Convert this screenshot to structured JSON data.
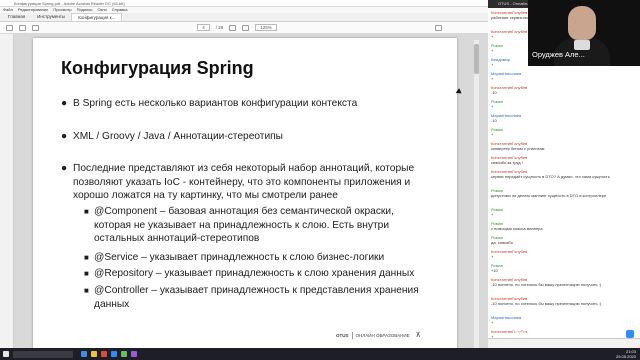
{
  "reader": {
    "window_title": "Конфигурация Spring.pdf - Adobe Acrobat Reader DC (64-bit)",
    "menu": [
      "Файл",
      "Редактирование",
      "Просмотр",
      "Подпись",
      "Окно",
      "Справка"
    ],
    "tabs": [
      "Главная",
      "Инструменты",
      "Конфигурация к..."
    ],
    "page_current": "4",
    "page_total": "/ 26",
    "zoom": "125%"
  },
  "slide": {
    "title": "Конфигурация Spring",
    "bullets": [
      "В Spring есть несколько вариантов конфигурации контекста",
      "XML / Groovy / Java / Аннотации-стереотипы"
    ],
    "bullet3_lines": [
      "Последние представляют из себя некоторый набор аннотаций, которые",
      "позволяют указать IoC - контейнеру, что  это компоненты приложения и",
      "хорошо ложатся на ту картинку, что мы смотрели ранее"
    ],
    "sub1_lines": [
      "@Component – базовая аннотация без семантической окраски,",
      "которая не указывает на принадлежность к слою. Есть внутри",
      "остальных аннотаций-стереотипов"
    ],
    "sub2": "@Service – указывает принадлежность к слою бизнес-логики",
    "sub3": "@Repository – указывает принадлежность к слою хранения данных",
    "sub4_lines": [
      "@Controller – указывает принадлежность к представления хранения",
      "данных"
    ],
    "footer_brand": "OTUS",
    "footer_text": "ОНЛАЙН ОБРАЗОВАНИЕ"
  },
  "chat": {
    "title": "OTUS - Онлайн-образование",
    "messages": [
      {
        "who": "КонстантинГолубев",
        "text": "работают сервисом application.yaml"
      },
      {
        "who": "КонстантинГолубев",
        "text": "+"
      },
      {
        "who": "Роман",
        "text": "+"
      },
      {
        "who": "Владимир",
        "text": "+"
      },
      {
        "who": "МаринНиколаев",
        "text": "+"
      },
      {
        "who": "КонстантинГолубев",
        "text": "-10"
      },
      {
        "who": "Роман",
        "text": "+"
      },
      {
        "who": "МаринНиколаев",
        "text": "-10"
      },
      {
        "who": "Роман",
        "text": "+"
      },
      {
        "who": "КонстантинГолубев",
        "text": "конвертер бином с утилитам"
      },
      {
        "who": "КонстантинГолубев",
        "text": "спасибо за труд !"
      },
      {
        "who": "КонстантинГолубев",
        "text": "сервис передаёт сущность в DTO? А думал, что сама сущность"
      },
      {
        "who": "Роман",
        "text": "допустимо ли делать маппинг сущность в DTO в контроллере"
      },
      {
        "who": "Роман",
        "text": "+"
      },
      {
        "who": "Роман",
        "text": "с помощью класса маппера"
      },
      {
        "who": "Роман",
        "text": "да, спасибо"
      },
      {
        "who": "КонстантинГолубев",
        "text": "+"
      },
      {
        "who": "Роман",
        "text": "+10"
      },
      {
        "who": "КонстантинГолубев",
        "text": "-10 понятно, но хотелось бы вашу презентацию получить :)"
      },
      {
        "who": "КонстантинГолубев",
        "text": "-10 понятно, но хотелось бы вашу презентацию получить :)"
      },
      {
        "who": "МаринНиколаев",
        "text": "+"
      },
      {
        "who": "КонстантинГолубев",
        "text": "+"
      }
    ]
  },
  "video": {
    "name": "Оруджев Але..."
  },
  "watermark": "zoom",
  "taskbar": {
    "time": "21:03",
    "date": "29.05.2020"
  }
}
